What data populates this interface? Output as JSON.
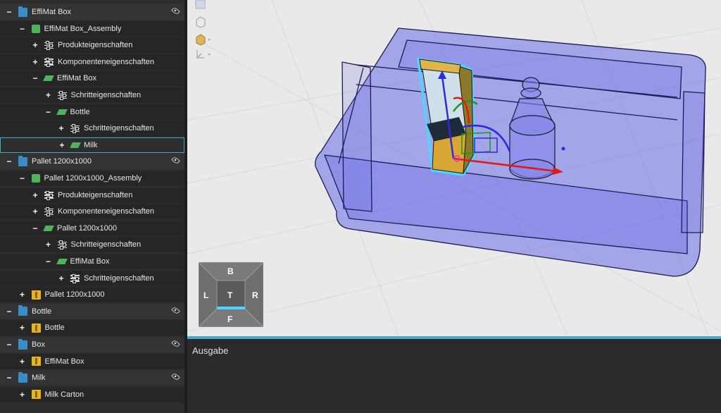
{
  "tree": {
    "rows": [
      {
        "label": "EffiMat Box",
        "toggle": "−",
        "icon": "folder-icon",
        "indent": 0,
        "eye": true,
        "style": "light"
      },
      {
        "label": "EffiMat Box_Assembly",
        "toggle": "−",
        "icon": "assembly-icon",
        "indent": 1,
        "eye": false,
        "style": "dark"
      },
      {
        "label": "Produkteigenschaften",
        "toggle": "+",
        "icon": "properties-icon",
        "indent": 2,
        "eye": false,
        "style": "dark"
      },
      {
        "label": "Komponenteneigenschaften",
        "toggle": "+",
        "icon": "properties-icon",
        "indent": 2,
        "eye": false,
        "style": "dark"
      },
      {
        "label": "EffiMat Box",
        "toggle": "−",
        "icon": "part-icon",
        "indent": 2,
        "eye": false,
        "style": "dark"
      },
      {
        "label": "Schritteigenschaften",
        "toggle": "+",
        "icon": "properties-icon",
        "indent": 3,
        "eye": false,
        "style": "dark"
      },
      {
        "label": "Bottle",
        "toggle": "−",
        "icon": "part-icon",
        "indent": 3,
        "eye": false,
        "style": "dark"
      },
      {
        "label": "Schritteigenschaften",
        "toggle": "+",
        "icon": "properties-icon",
        "indent": 4,
        "eye": false,
        "style": "dark"
      },
      {
        "label": "Milk",
        "toggle": "+",
        "icon": "part-icon",
        "indent": 4,
        "eye": false,
        "style": "selected"
      },
      {
        "label": "Pallet 1200x1000",
        "toggle": "−",
        "icon": "folder-icon",
        "indent": 0,
        "eye": true,
        "style": "light"
      },
      {
        "label": "Pallet 1200x1000_Assembly",
        "toggle": "−",
        "icon": "assembly-icon",
        "indent": 1,
        "eye": false,
        "style": "dark"
      },
      {
        "label": "Produkteigenschaften",
        "toggle": "+",
        "icon": "properties-icon",
        "indent": 2,
        "eye": false,
        "style": "dark"
      },
      {
        "label": "Komponenteneigenschaften",
        "toggle": "+",
        "icon": "properties-icon",
        "indent": 2,
        "eye": false,
        "style": "dark"
      },
      {
        "label": "Pallet 1200x1000",
        "toggle": "−",
        "icon": "part-icon",
        "indent": 2,
        "eye": false,
        "style": "dark"
      },
      {
        "label": "Schritteigenschaften",
        "toggle": "+",
        "icon": "properties-icon",
        "indent": 3,
        "eye": false,
        "style": "dark"
      },
      {
        "label": "EffiMat Box",
        "toggle": "−",
        "icon": "part-icon",
        "indent": 3,
        "eye": false,
        "style": "dark"
      },
      {
        "label": "Schritteigenschaften",
        "toggle": "+",
        "icon": "properties-icon",
        "indent": 4,
        "eye": false,
        "style": "dark"
      },
      {
        "label": "Pallet 1200x1000",
        "toggle": "+",
        "icon": "box-icon",
        "indent": 1,
        "eye": false,
        "style": "dark"
      },
      {
        "label": "Bottle",
        "toggle": "−",
        "icon": "folder-icon",
        "indent": 0,
        "eye": true,
        "style": "light"
      },
      {
        "label": "Bottle",
        "toggle": "+",
        "icon": "box-icon",
        "indent": 1,
        "eye": false,
        "style": "dark"
      },
      {
        "label": "Box",
        "toggle": "−",
        "icon": "folder-icon",
        "indent": 0,
        "eye": true,
        "style": "light"
      },
      {
        "label": "EffiMat Box",
        "toggle": "+",
        "icon": "box-icon",
        "indent": 1,
        "eye": false,
        "style": "dark"
      },
      {
        "label": "Milk",
        "toggle": "−",
        "icon": "folder-icon",
        "indent": 0,
        "eye": true,
        "style": "light"
      },
      {
        "label": "Milk Carton",
        "toggle": "+",
        "icon": "box-icon",
        "indent": 1,
        "eye": false,
        "style": "dark"
      }
    ]
  },
  "viewport": {
    "navcube": {
      "top": "B",
      "bottom": "F",
      "left": "L",
      "right": "R",
      "center": "T"
    }
  },
  "output": {
    "title": "Ausgabe"
  },
  "colors": {
    "accent": "#4aa8c8",
    "box_tint": "#6b6be8",
    "selection_outline": "#4fd6ff"
  }
}
